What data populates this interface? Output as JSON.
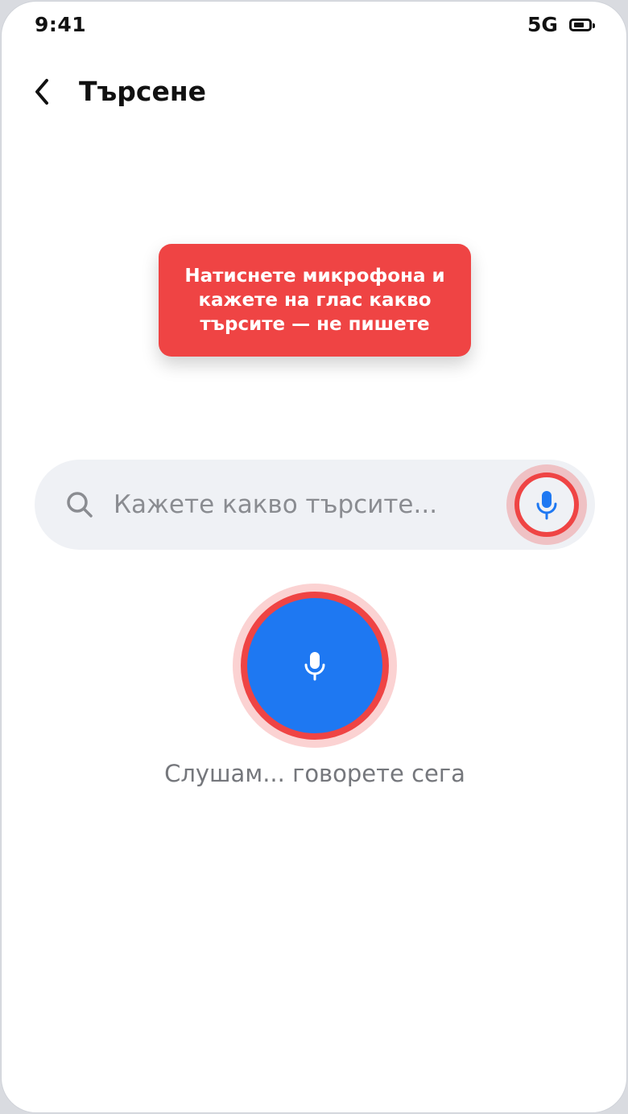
{
  "status_bar": {
    "time": "9:41",
    "network": "5G"
  },
  "header": {
    "title": "Търсене",
    "back_icon": "chevron-left-icon"
  },
  "tooltip": {
    "text": "Натиснете микрофона и кажете на глас какво търсите — не пишете"
  },
  "search": {
    "placeholder": "Кажете какво търсите...",
    "value": "",
    "search_icon": "search-icon",
    "mic_icon": "microphone-icon"
  },
  "voice": {
    "mic_icon": "microphone-icon",
    "status": "Слушам... говорете сега"
  },
  "colors": {
    "accent_blue": "#1e78f2",
    "highlight_red": "#ef4444",
    "search_bg": "#eff1f5",
    "text_dark": "#111111",
    "text_muted": "#75777c"
  }
}
